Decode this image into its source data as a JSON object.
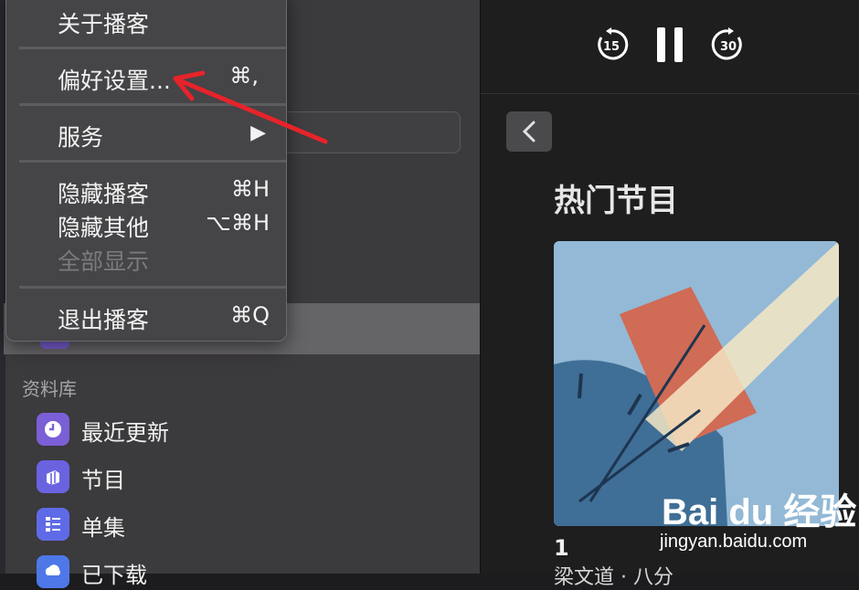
{
  "app_menu": {
    "items": [
      {
        "label": "关于播客",
        "shortcut": ""
      },
      {
        "label": "偏好设置...",
        "shortcut": "⌘,"
      },
      {
        "label": "服务",
        "shortcut": "▶"
      },
      {
        "label": "隐藏播客",
        "shortcut": "⌘H"
      },
      {
        "label": "隐藏其他",
        "shortcut": "⌥⌘H"
      },
      {
        "label": "全部显示",
        "shortcut": ""
      },
      {
        "label": "退出播客",
        "shortcut": "⌘Q"
      }
    ]
  },
  "sidebar": {
    "library_heading": "资料库",
    "library_items": [
      {
        "label": "最近更新",
        "icon": "clock-icon"
      },
      {
        "label": "节目",
        "icon": "shows-icon"
      },
      {
        "label": "单集",
        "icon": "list-icon"
      },
      {
        "label": "已下载",
        "icon": "download-cloud-icon"
      }
    ]
  },
  "player": {
    "skip_back_seconds": "15",
    "skip_forward_seconds": "30",
    "section_title": "热门节目",
    "episode_number": "1",
    "episode_subtitle": "梁文道 · 八分"
  },
  "watermark": {
    "brand": "Bai du 经验",
    "url": "jingyan.baidu.com"
  },
  "colors": {
    "menu_bg": "#454447",
    "sidebar_bg": "#3b3a3c",
    "player_bg": "#1e1e1e",
    "annotation_arrow": "#e8232a",
    "library_icon": "#7b5fd6"
  }
}
